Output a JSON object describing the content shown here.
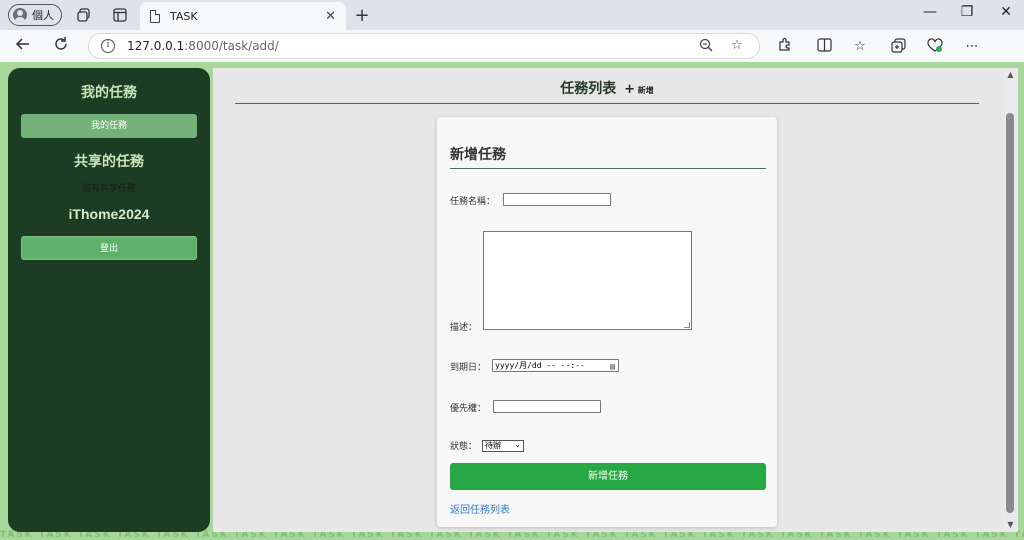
{
  "browser": {
    "profile_label": "個人",
    "tab_title": "TASK",
    "url_host": "127.0.0.1",
    "url_rest": ":8000/task/add/"
  },
  "sidebar": {
    "title": "我的任務",
    "my_tasks_button": "我的任務",
    "shared_title": "共享的任務",
    "no_shared_text": "沒有共享任務",
    "username": "iThome2024",
    "logout_button": "登出"
  },
  "header": {
    "title": "任務列表",
    "add_label": "新增",
    "add_symbol": "+"
  },
  "form": {
    "title": "新增任務",
    "name_label": "任務名稱：",
    "name_value": "",
    "description_label": "描述：",
    "description_value": "",
    "due_label": "到期日：",
    "due_placeholder": "yyyy/月/dd -- --:--",
    "priority_label": "優先權：",
    "priority_value": "",
    "status_label": "狀態：",
    "status_value": "待辦",
    "submit_button": "新增任務",
    "back_link": "返回任務列表"
  },
  "footer_pattern_text": "TASK TASK TASK TASK TASK TASK TASK TASK TASK TASK TASK TASK TASK TASK TASK TASK TASK TASK TASK TASK TASK TASK TASK TASK TASK TASK TASK TASK TASK TASK TASK TASK",
  "icons": {
    "back": "arrow-left-icon",
    "refresh": "refresh-icon",
    "calendar": "calendar-icon"
  },
  "colors": {
    "sidebar_bg": "#1c3c23",
    "page_bg": "#a7d79b",
    "submit_bg": "#28a745",
    "link": "#2f7fd6"
  }
}
